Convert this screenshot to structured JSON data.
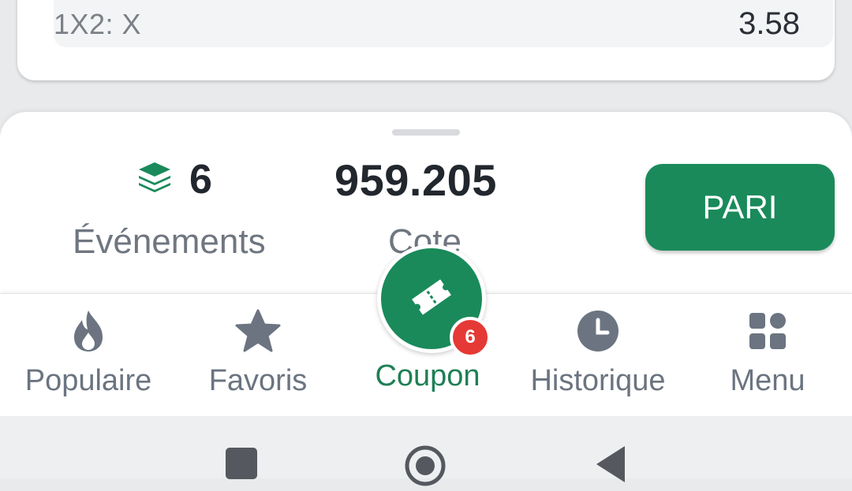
{
  "bet": {
    "label": "1X2: X",
    "odds": "3.58"
  },
  "summary": {
    "events_count": "6",
    "events_label": "Événements",
    "total_odds": "959.205",
    "odds_label": "Cote",
    "pari_label": "PARI",
    "events_icon": "layers-icon"
  },
  "nav": {
    "items": [
      {
        "label": "Populaire",
        "icon": "fire-icon"
      },
      {
        "label": "Favoris",
        "icon": "star-icon"
      },
      {
        "label": "Coupon",
        "icon": "ticket-icon",
        "badge": "6",
        "active": true
      },
      {
        "label": "Historique",
        "icon": "clock-icon"
      },
      {
        "label": "Menu",
        "icon": "grid-icon"
      }
    ]
  },
  "system_nav": [
    "recents-button",
    "home-button",
    "back-button"
  ],
  "colors": {
    "accent": "#1a8a5b",
    "badge": "#e53935",
    "text_dark": "#22272e",
    "text_muted": "#6f7680",
    "icon_muted": "#6b7480"
  }
}
